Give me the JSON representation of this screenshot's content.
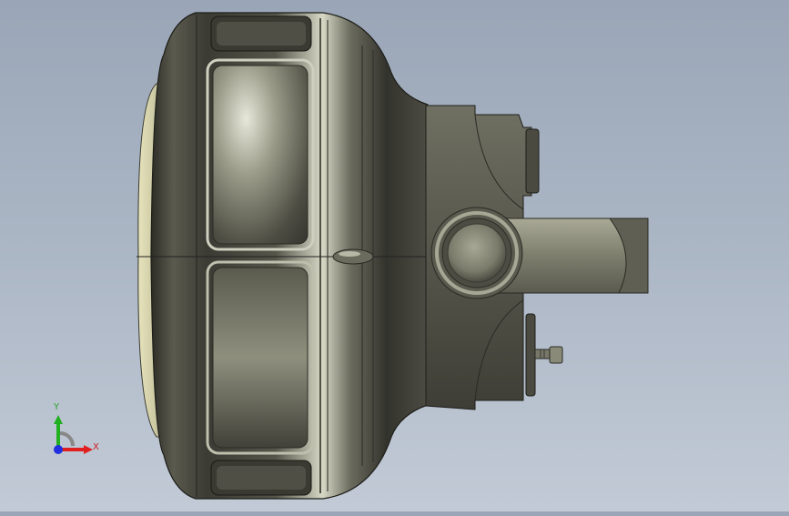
{
  "viewport": {
    "model": "lamp-housing-assembly",
    "view_orientation": "front"
  },
  "triad": {
    "x_label": "X",
    "y_label": "Y",
    "x_color": "#e02020",
    "y_color": "#20b020",
    "z_color": "#2030e0"
  },
  "colors": {
    "background_top": "#9aa6b7",
    "background_bottom": "#c2cad6",
    "body_shade": "#4a4a42",
    "body_highlight": "#c8c8b4",
    "lens_tint": "#d8d6b0"
  }
}
